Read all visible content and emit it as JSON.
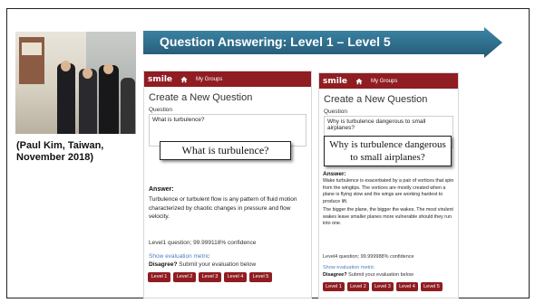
{
  "banner": {
    "title": "Question Answering:  Level 1 – Level 5"
  },
  "photo_caption": "(Paul Kim, Taiwan,\nNovember 2018)",
  "app_left": {
    "logo": "smile",
    "nav_label": "My Groups",
    "page_title": "Create a New Question",
    "question_label": "Question",
    "question_value": "What is turbulence?",
    "callout": "What is turbulence?",
    "answer_label": "Answer:",
    "answer_text": "Turbulence or turbulent flow is any pattern of fluid motion characterized by chaotic changes in pressure and flow velocity.",
    "confidence": "Level1 question; 99.999118% confidence",
    "metric_link": "Show evaluation metric",
    "disagree_label": "Disagree?",
    "disagree_text": "Submit your evaluation below",
    "levels": [
      "Level 1",
      "Level 2",
      "Level 3",
      "Level 4",
      "Level 5"
    ]
  },
  "app_right": {
    "logo": "smile",
    "nav_label": "My Groups",
    "page_title": "Create a New Question",
    "question_label": "Question",
    "question_value": "Why is turbulence dangerous to small airplanes?",
    "callout": "Why is turbulence dangerous to small airplanes?",
    "answer_label": "Answer:",
    "answer_p1": "Wake turbulence is exacerbated by a pair of vortices that spin from the wingtips. The vortices are mostly created when a plane is flying slow and the wings are working hardest to produce lift.",
    "answer_p2": "The bigger the plane, the bigger the wakes. The most virulent wakes leave smaller planes more vulnerable should they run into one.",
    "confidence": "Level4 question; 99.999988% confidence",
    "metric_link": "Show evaluation metric",
    "disagree_label": "Disagree?",
    "disagree_text": "Submit your evaluation below",
    "levels": [
      "Level 1",
      "Level 2",
      "Level 3",
      "Level 4",
      "Level 5"
    ]
  },
  "colors": {
    "banner": "#2e6f8f",
    "app_bar": "#8f1d22",
    "link": "#4a7fc0"
  },
  "icons": {
    "home": "home-icon"
  }
}
